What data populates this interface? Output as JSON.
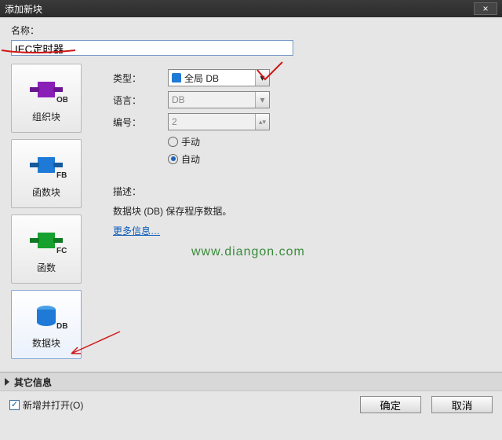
{
  "window": {
    "title": "添加新块"
  },
  "name": {
    "label": "名称：",
    "value": "IEC定时器"
  },
  "blocks": {
    "ob": {
      "tag": "OB",
      "label": "组织块",
      "color": "#8a1fb8"
    },
    "fb": {
      "tag": "FB",
      "label": "函数块",
      "color": "#1e7ad6"
    },
    "fc": {
      "tag": "FC",
      "label": "函数",
      "color": "#16a02e"
    },
    "db": {
      "tag": "DB",
      "label": "数据块",
      "color": "#1e7ad6"
    }
  },
  "form": {
    "type_label": "类型：",
    "type_value": "全局 DB",
    "lang_label": "语言：",
    "lang_value": "DB",
    "num_label": "编号：",
    "num_value": "2",
    "manual": "手动",
    "auto": "自动",
    "desc_label": "描述：",
    "desc_text": "数据块 (DB) 保存程序数据。",
    "more_link": "更多信息…"
  },
  "watermark": "www.diangon.com",
  "expander": {
    "label": "其它信息"
  },
  "footer": {
    "add_open": "新增并打开(O)",
    "ok": "确定",
    "cancel": "取消"
  }
}
